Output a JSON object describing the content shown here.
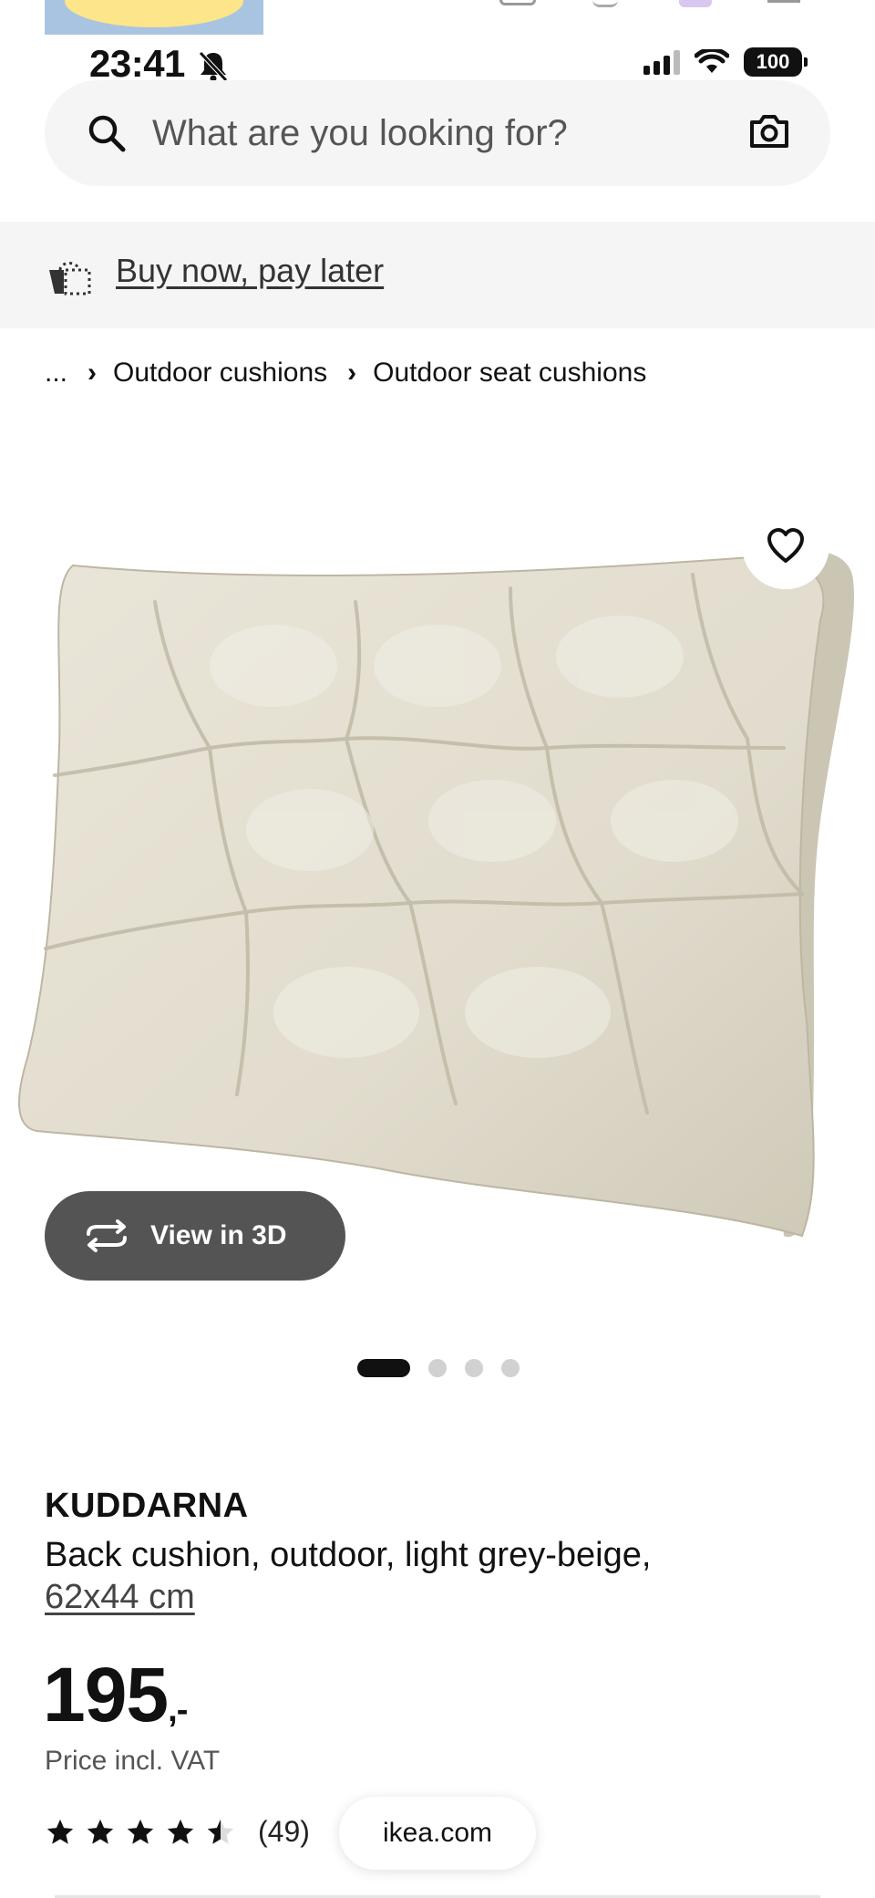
{
  "status_bar": {
    "time": "23:41",
    "battery": "100"
  },
  "search": {
    "placeholder": "What are you looking for?"
  },
  "banner": {
    "link_label": "Buy now, pay later"
  },
  "breadcrumb": {
    "items": [
      "...",
      "Outdoor cushions",
      "Outdoor seat cushions"
    ]
  },
  "gallery": {
    "view_3d_label": "View in 3D",
    "slide_count": 4,
    "active_slide": 1
  },
  "product": {
    "brand": "KUDDARNA",
    "description": "Back cushion, outdoor, light grey-beige,",
    "size": "62x44 cm",
    "price": "195",
    "price_suffix": ",-",
    "price_note": "Price incl. VAT",
    "rating": 4.5,
    "review_count": "(49)"
  },
  "browser": {
    "domain": "ikea.com"
  },
  "colors": {
    "cushion": "#e6e1d3",
    "button_dark": "#545454",
    "surface_grey": "#f5f5f5"
  }
}
